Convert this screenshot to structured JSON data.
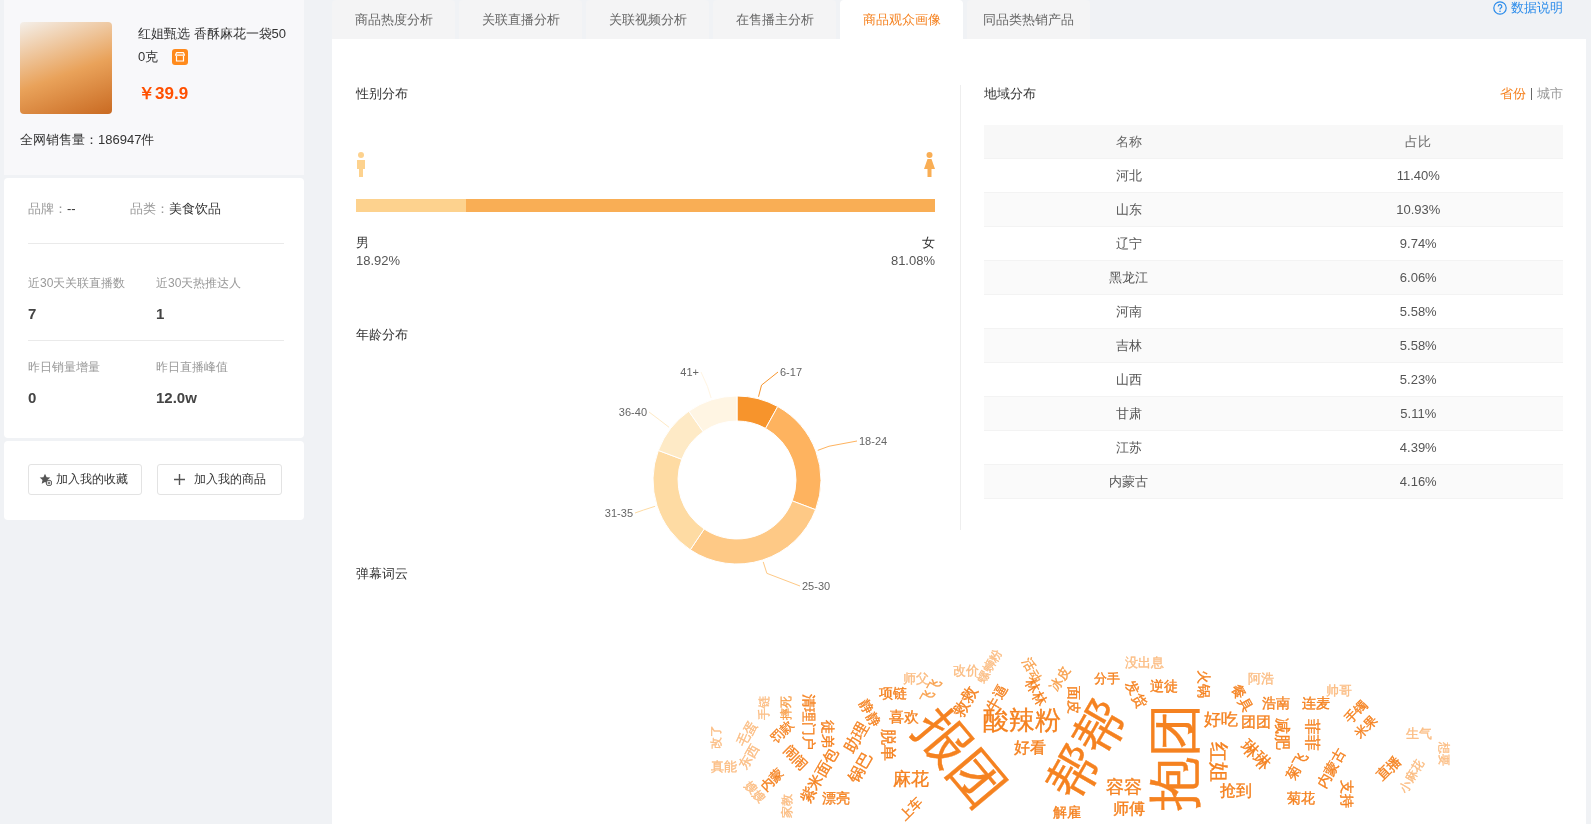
{
  "product": {
    "title": "红姐甄选 香酥麻花一袋500克",
    "price": "￥39.9",
    "sales": "全网销售量：186947件"
  },
  "attributes": [
    {
      "label": "品牌：",
      "value": "--"
    },
    {
      "label": "品类：",
      "value": "美食饮品"
    }
  ],
  "stats": [
    {
      "label": "近30天关联直播数",
      "value": "7"
    },
    {
      "label": "近30天热推达人",
      "value": "1"
    },
    {
      "label": "昨日销量增量",
      "value": "0"
    },
    {
      "label": "昨日直播峰值",
      "value": "12.0w"
    }
  ],
  "actions": [
    {
      "label": "加入我的收藏",
      "kind": "favorite"
    },
    {
      "label": "加入我的商品",
      "kind": "add"
    }
  ],
  "tabs": [
    {
      "label": "商品热度分析",
      "selected": false
    },
    {
      "label": "关联直播分析",
      "selected": false
    },
    {
      "label": "关联视频分析",
      "selected": false
    },
    {
      "label": "在售播主分析",
      "selected": false
    },
    {
      "label": "商品观众画像",
      "selected": true
    },
    {
      "label": "同品类热销产品",
      "selected": false
    }
  ],
  "help_link": "数据说明",
  "gender": {
    "title": "性别分布",
    "male": {
      "label": "男",
      "reading": "18.92%",
      "level": 0.1892
    },
    "female": {
      "label": "女",
      "reading": "81.08%",
      "level": 0.8108
    }
  },
  "age": {
    "title": "年龄分布",
    "segments": [
      {
        "label": "6-17",
        "color": "#f7942c"
      },
      {
        "label": "18-24",
        "color": "#feb35f"
      },
      {
        "label": "25-30",
        "color": "#fec986"
      },
      {
        "label": "31-35",
        "color": "#fedba3"
      },
      {
        "label": "36-40",
        "color": "#feeac6"
      },
      {
        "label": "41+",
        "color": "#fff5e3"
      }
    ]
  },
  "region": {
    "title": "地域分布",
    "toggles": [
      {
        "label": "省份",
        "selected": true
      },
      {
        "label": "城市",
        "selected": false
      }
    ],
    "columns": [
      "名称",
      "占比"
    ],
    "rows": [
      [
        "河北",
        "11.40%"
      ],
      [
        "山东",
        "10.93%"
      ],
      [
        "辽宁",
        "9.74%"
      ],
      [
        "黑龙江",
        "6.06%"
      ],
      [
        "河南",
        "5.58%"
      ],
      [
        "吉林",
        "5.58%"
      ],
      [
        "山西",
        "5.23%"
      ],
      [
        "甘肃",
        "5.11%"
      ],
      [
        "江苏",
        "4.39%"
      ],
      [
        "内蒙古",
        "4.16%"
      ]
    ]
  },
  "wordcloud": {
    "title": "弹幕词云",
    "words": [
      {
        "text": "师父",
        "color": "#fbbd83"
      },
      {
        "text": "改价",
        "color": "#fbbd83"
      },
      {
        "text": "螺蛳粉",
        "color": "#fbbd83"
      },
      {
        "text": "活动",
        "color": "#f8a04c"
      },
      {
        "text": "冰皮",
        "color": "#f8a04c"
      },
      {
        "text": "分手",
        "color": "#f58220"
      },
      {
        "text": "没出息",
        "color": "#fbbd83"
      },
      {
        "text": "阿浩",
        "color": "#fbbd83"
      },
      {
        "text": "手链",
        "color": "#fbbd83"
      },
      {
        "text": "摔死",
        "color": "#f8a04c"
      },
      {
        "text": "静静",
        "color": "#f58220"
      },
      {
        "text": "项链",
        "color": "#f58220"
      },
      {
        "text": "飞飞",
        "color": "#f8a04c"
      },
      {
        "text": "救救",
        "color": "#f58220"
      },
      {
        "text": "牛逼",
        "color": "#f58220"
      },
      {
        "text": "林林",
        "color": "#f58220"
      },
      {
        "text": "面皮",
        "color": "#f58220"
      },
      {
        "text": "发货",
        "color": "#f58220"
      },
      {
        "text": "逆徒",
        "color": "#f58220"
      },
      {
        "text": "火锅",
        "color": "#f58220"
      },
      {
        "text": "餐具",
        "color": "#f58220"
      },
      {
        "text": "浩南",
        "color": "#f58220"
      },
      {
        "text": "连麦",
        "color": "#f58220"
      },
      {
        "text": "帅哥",
        "color": "#fbbd83"
      },
      {
        "text": "手镯",
        "color": "#f58220"
      },
      {
        "text": "改了",
        "color": "#fbbd83"
      },
      {
        "text": "毛蛋",
        "color": "#fbbd83"
      },
      {
        "text": "罚款",
        "color": "#f58220"
      },
      {
        "text": "清理门户",
        "color": "#f58220"
      },
      {
        "text": "徒弟",
        "color": "#f58220"
      },
      {
        "text": "助理",
        "color": "#f58220"
      },
      {
        "text": "脱单",
        "color": "#f58220"
      },
      {
        "text": "喜欢",
        "color": "#f58220"
      },
      {
        "text": "酸辣粉",
        "color": "#f58220"
      },
      {
        "text": "好看",
        "color": "#f58220"
      },
      {
        "text": "好吃",
        "color": "#f58220"
      },
      {
        "text": "团团",
        "color": "#f58220"
      },
      {
        "text": "减肥",
        "color": "#f58220"
      },
      {
        "text": "菲菲",
        "color": "#f58220"
      },
      {
        "text": "米果",
        "color": "#f58220"
      },
      {
        "text": "生气",
        "color": "#fbbd83"
      },
      {
        "text": "真能",
        "color": "#fbbd83"
      },
      {
        "text": "东西",
        "color": "#fbbd83"
      },
      {
        "text": "内蒙",
        "color": "#f58220"
      },
      {
        "text": "闹闹",
        "color": "#f58220"
      },
      {
        "text": "紫米面包",
        "color": "#f58220"
      },
      {
        "text": "锅巴",
        "color": "#f58220"
      },
      {
        "text": "麻花",
        "color": "#f58220"
      },
      {
        "text": "报团",
        "color": "#f58220"
      },
      {
        "text": "帮帮",
        "color": "#f58220"
      },
      {
        "text": "抱团",
        "color": "#f58220"
      },
      {
        "text": "红姐",
        "color": "#f58220"
      },
      {
        "text": "琳琳",
        "color": "#f58220"
      },
      {
        "text": "菊飞",
        "color": "#f58220"
      },
      {
        "text": "内蒙古",
        "color": "#f58220"
      },
      {
        "text": "直播",
        "color": "#f58220"
      },
      {
        "text": "小麻花",
        "color": "#fbbd83"
      },
      {
        "text": "想要",
        "color": "#fbbd83"
      },
      {
        "text": "嫂嫂",
        "color": "#fbbd83"
      },
      {
        "text": "家教",
        "color": "#fbbd83"
      },
      {
        "text": "漂亮",
        "color": "#f58220"
      },
      {
        "text": "上车",
        "color": "#f58220"
      },
      {
        "text": "解雇",
        "color": "#f58220"
      },
      {
        "text": "容容",
        "color": "#f58220"
      },
      {
        "text": "师傅",
        "color": "#f58220"
      },
      {
        "text": "抢到",
        "color": "#f58220"
      },
      {
        "text": "菊花",
        "color": "#f58220"
      },
      {
        "text": "支持",
        "color": "#f58220"
      }
    ]
  }
}
